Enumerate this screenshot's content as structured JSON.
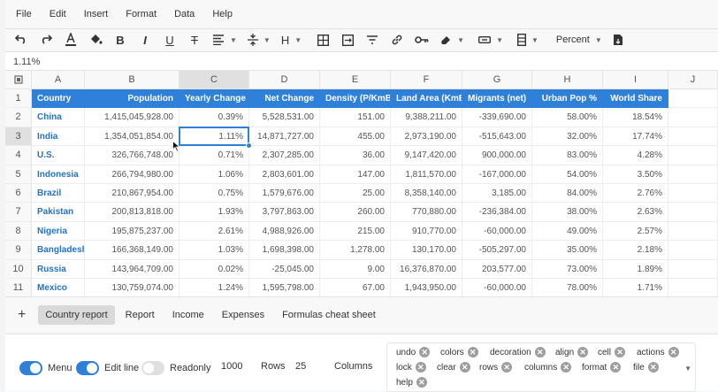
{
  "menu": [
    "File",
    "Edit",
    "Insert",
    "Format",
    "Data",
    "Help"
  ],
  "toolbar": {
    "format_value": "Percent",
    "heading_label": "H"
  },
  "formula_bar": {
    "value": "1.11%"
  },
  "columns": [
    "A",
    "B",
    "C",
    "D",
    "E",
    "F",
    "G",
    "H",
    "I",
    "J"
  ],
  "rows": [
    "1",
    "2",
    "3",
    "4",
    "5",
    "6",
    "7",
    "8",
    "9",
    "10",
    "11"
  ],
  "table_headers": [
    "Country",
    "Population",
    "Yearly Change",
    "Net Change",
    "Density (P/KmBI)",
    "Land Area (KmBI)",
    "Migrants (net)",
    "Urban Pop %",
    "World Share"
  ],
  "table_rows": [
    [
      "China",
      "1,415,045,928.00",
      "0.39%",
      "5,528,531.00",
      "151.00",
      "9,388,211.00",
      "-339,690.00",
      "58.00%",
      "18.54%"
    ],
    [
      "India",
      "1,354,051,854.00",
      "1.11%",
      "14,871,727.00",
      "455.00",
      "2,973,190.00",
      "-515,643.00",
      "32.00%",
      "17.74%"
    ],
    [
      "U.S.",
      "326,766,748.00",
      "0.71%",
      "2,307,285.00",
      "36.00",
      "9,147,420.00",
      "900,000.00",
      "83.00%",
      "4.28%"
    ],
    [
      "Indonesia",
      "266,794,980.00",
      "1.06%",
      "2,803,601.00",
      "147.00",
      "1,811,570.00",
      "-167,000.00",
      "54.00%",
      "3.50%"
    ],
    [
      "Brazil",
      "210,867,954.00",
      "0.75%",
      "1,579,676.00",
      "25.00",
      "8,358,140.00",
      "3,185.00",
      "84.00%",
      "2.76%"
    ],
    [
      "Pakistan",
      "200,813,818.00",
      "1.93%",
      "3,797,863.00",
      "260.00",
      "770,880.00",
      "-236,384.00",
      "38.00%",
      "2.63%"
    ],
    [
      "Nigeria",
      "195,875,237.00",
      "2.61%",
      "4,988,926.00",
      "215.00",
      "910,770.00",
      "-60,000.00",
      "49.00%",
      "2.57%"
    ],
    [
      "Bangladesh",
      "166,368,149.00",
      "1.03%",
      "1,698,398.00",
      "1,278.00",
      "130,170.00",
      "-505,297.00",
      "35.00%",
      "2.18%"
    ],
    [
      "Russia",
      "143,964,709.00",
      "0.02%",
      "-25,045.00",
      "9.00",
      "16,376,870.00",
      "203,577.00",
      "73.00%",
      "1.89%"
    ],
    [
      "Mexico",
      "130,759,074.00",
      "1.24%",
      "1,595,798.00",
      "67.00",
      "1,943,950.00",
      "-60,000.00",
      "78.00%",
      "1.71%"
    ]
  ],
  "sheet_tabs": [
    "Country report",
    "Report",
    "Income",
    "Expenses",
    "Formulas cheat sheet"
  ],
  "panel": {
    "menu_label": "Menu",
    "editline_label": "Edit line",
    "readonly_label": "Readonly",
    "cols_count": "1000",
    "rows_label": "Rows",
    "rows_count": "25",
    "columns_label": "Columns",
    "chips": [
      "undo",
      "colors",
      "decoration",
      "align",
      "cell",
      "actions",
      "lock",
      "clear",
      "rows",
      "columns",
      "format",
      "file",
      "help"
    ]
  },
  "colors": {
    "accent": "#2f80d8",
    "header_bg": "#2f80d8",
    "country_text": "#2472c8"
  },
  "icons": [
    "undo-icon",
    "redo-icon",
    "text-color-icon",
    "fill-color-icon",
    "bold-icon",
    "italic-icon",
    "underline-icon",
    "strikethrough-icon",
    "align-icon",
    "vertical-align-icon",
    "heading-icon",
    "border-icon",
    "merge-icon",
    "filter-icon",
    "link-icon",
    "lock-key-icon",
    "eraser-icon",
    "number-format-icon",
    "column-format-icon",
    "export-icon"
  ]
}
